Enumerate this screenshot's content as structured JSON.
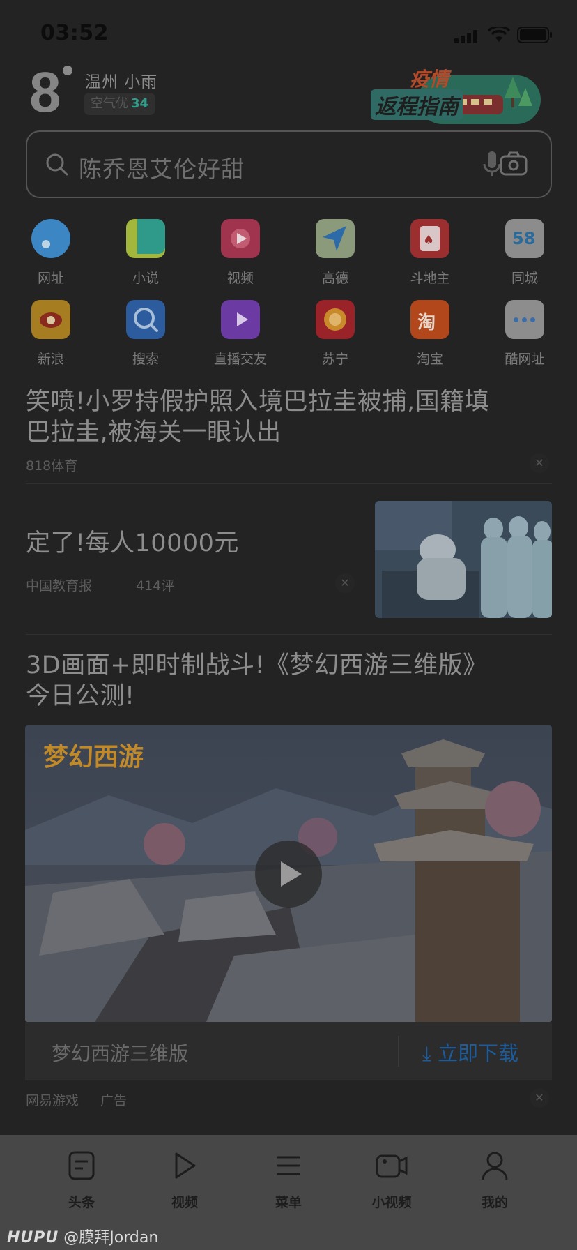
{
  "status_bar": {
    "time": "03:52"
  },
  "weather": {
    "temperature": "8",
    "city_condition": "温州 小雨",
    "aqi_label": "空气优",
    "aqi_value": "34"
  },
  "banner": {
    "line1": "疫情",
    "line2": "返程指南"
  },
  "search": {
    "placeholder": "陈乔恩艾伦好甜"
  },
  "shortcuts": [
    {
      "label": "网址",
      "icon": "globe-icon",
      "color": "#3d86c4"
    },
    {
      "label": "小说",
      "icon": "book-icon",
      "color": "#a3b73c"
    },
    {
      "label": "视频",
      "icon": "video-play-icon",
      "color": "#a0344e"
    },
    {
      "label": "高德",
      "icon": "map-arrow-icon",
      "color": "#3b7ba4"
    },
    {
      "label": "斗地主",
      "icon": "poker-card-icon",
      "color": "#9b2e2e"
    },
    {
      "label": "同城",
      "icon": "58-icon",
      "color": "#8c8c8c"
    },
    {
      "label": "新浪",
      "icon": "weibo-eye-icon",
      "color": "#a67d20"
    },
    {
      "label": "搜索",
      "icon": "magnifier-icon",
      "color": "#2d5c9e"
    },
    {
      "label": "直播交友",
      "icon": "tv-icon",
      "color": "#6b3aa3"
    },
    {
      "label": "苏宁",
      "icon": "lion-icon",
      "color": "#9a2329"
    },
    {
      "label": "淘宝",
      "icon": "taobao-icon",
      "color": "#b2471b"
    },
    {
      "label": "酷网址",
      "icon": "more-dots-icon",
      "color": "#8d8d8d"
    }
  ],
  "feed": [
    {
      "title_lines": [
        "笑喷!小罗持假护照入境巴拉圭被捕,国籍填",
        "巴拉圭,被海关一眼认出"
      ],
      "source": "818体育"
    },
    {
      "title": "定了!每人10000元",
      "source": "中国教育报",
      "comments": "414评"
    },
    {
      "title_lines": [
        "3D画面+即时制战斗!《梦幻西游三维版》",
        "今日公测!"
      ],
      "video_logo": "梦幻西游",
      "ad_name": "梦幻西游三维版",
      "cta": "立即下载",
      "source": "网易游戏",
      "ad_tag": "广告"
    }
  ],
  "tabbar": [
    {
      "label": "头条",
      "icon": "news-icon"
    },
    {
      "label": "视频",
      "icon": "play-icon"
    },
    {
      "label": "菜单",
      "icon": "menu-icon"
    },
    {
      "label": "小视频",
      "icon": "camera-video-icon"
    },
    {
      "label": "我的",
      "icon": "user-icon"
    }
  ],
  "watermark": {
    "brand": "HUPU",
    "handle": "@膜拜Jordan"
  }
}
